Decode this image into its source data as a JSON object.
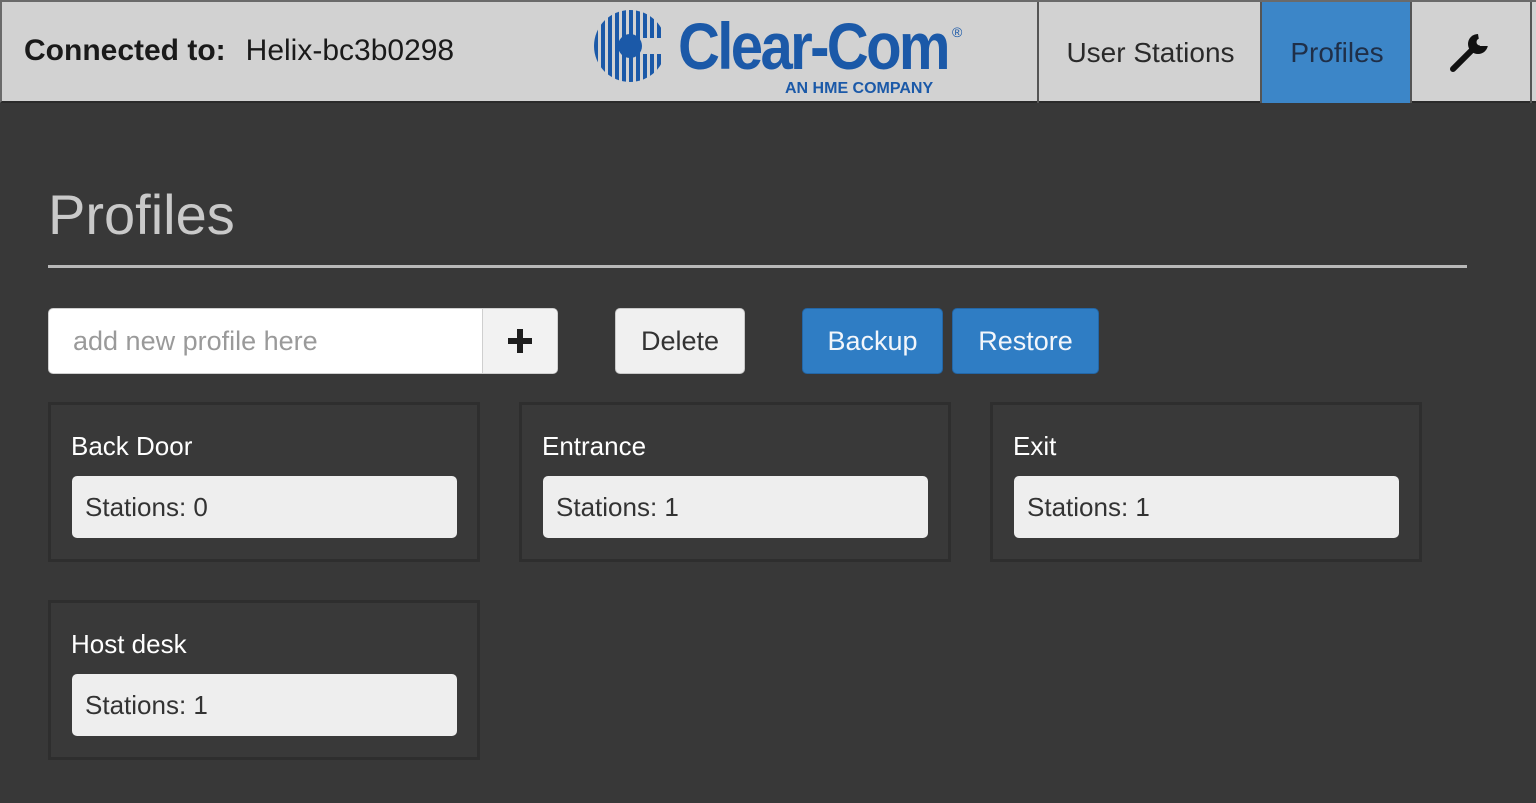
{
  "header": {
    "connected_label": "Connected to:",
    "connected_host": "Helix-bc3b0298",
    "logo": {
      "brand": "Clear-Com",
      "registered": "®",
      "tagline": "AN HME COMPANY",
      "color": "#1b59a8"
    },
    "nav": {
      "user_stations": "User Stations",
      "profiles": "Profiles",
      "tools_icon": "wrench-icon",
      "active": "profiles",
      "active_color": "#3c86c8"
    }
  },
  "page": {
    "title": "Profiles",
    "toolbar": {
      "add_placeholder": "add new profile here",
      "add_value": "",
      "add_icon": "plus-icon",
      "delete_label": "Delete",
      "backup_label": "Backup",
      "restore_label": "Restore",
      "accent_color": "#2f7dc4"
    },
    "profiles": [
      {
        "name": "Back Door",
        "stations": "Stations: 0"
      },
      {
        "name": "Entrance",
        "stations": "Stations: 1"
      },
      {
        "name": "Exit",
        "stations": "Stations: 1"
      },
      {
        "name": "Host desk",
        "stations": "Stations: 1"
      }
    ]
  }
}
